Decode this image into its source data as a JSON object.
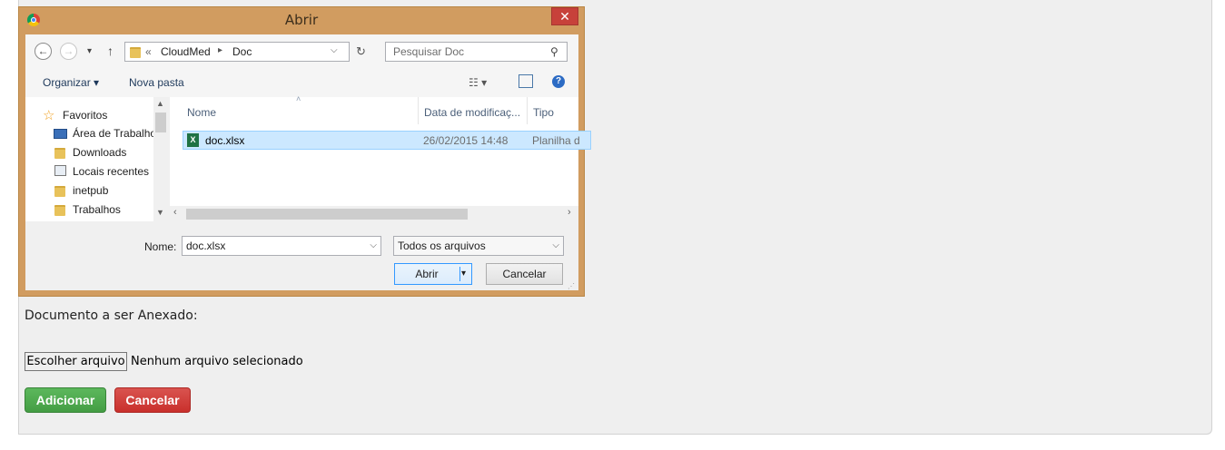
{
  "dialog": {
    "title": "Abrir",
    "close_label": "✕",
    "nav": {
      "breadcrumb": {
        "overflow": "«",
        "segments": [
          "CloudMed",
          "Doc"
        ]
      },
      "search_placeholder": "Pesquisar Doc"
    },
    "toolbar": {
      "organize_label": "Organizar ▾",
      "new_folder_label": "Nova pasta"
    },
    "sidebar": {
      "favorites_label": "Favoritos",
      "items": [
        {
          "label": "Área de Trabalho",
          "icon": "desktop-icon"
        },
        {
          "label": "Downloads",
          "icon": "downloads-folder-icon"
        },
        {
          "label": "Locais recentes",
          "icon": "recent-places-icon"
        },
        {
          "label": "inetpub",
          "icon": "folder-icon"
        },
        {
          "label": "Trabalhos",
          "icon": "folder-icon"
        }
      ]
    },
    "columns": [
      "Nome",
      "Data de modificaç...",
      "Tipo"
    ],
    "files": [
      {
        "name": "doc.xlsx",
        "modified": "26/02/2015 14:48",
        "type": "Planilha d",
        "icon": "excel-file-icon",
        "selected": true
      }
    ],
    "filename_label": "Nome:",
    "filename_value": "doc.xlsx",
    "filetype_value": "Todos os arquivos",
    "open_label": "Abrir",
    "cancel_label": "Cancelar"
  },
  "page": {
    "document_label": "Documento a ser Anexado:",
    "choose_file_label": "Escolher arquivo",
    "no_file_text": "Nenhum arquivo selecionado",
    "add_label": "Adicionar",
    "cancel_label": "Cancelar"
  },
  "colors": {
    "dialog_frame": "#d19c60",
    "close_button": "#c7413a",
    "selection": "#cce8ff",
    "add_button": "#5cb85c",
    "cancel_button": "#d9534f"
  }
}
